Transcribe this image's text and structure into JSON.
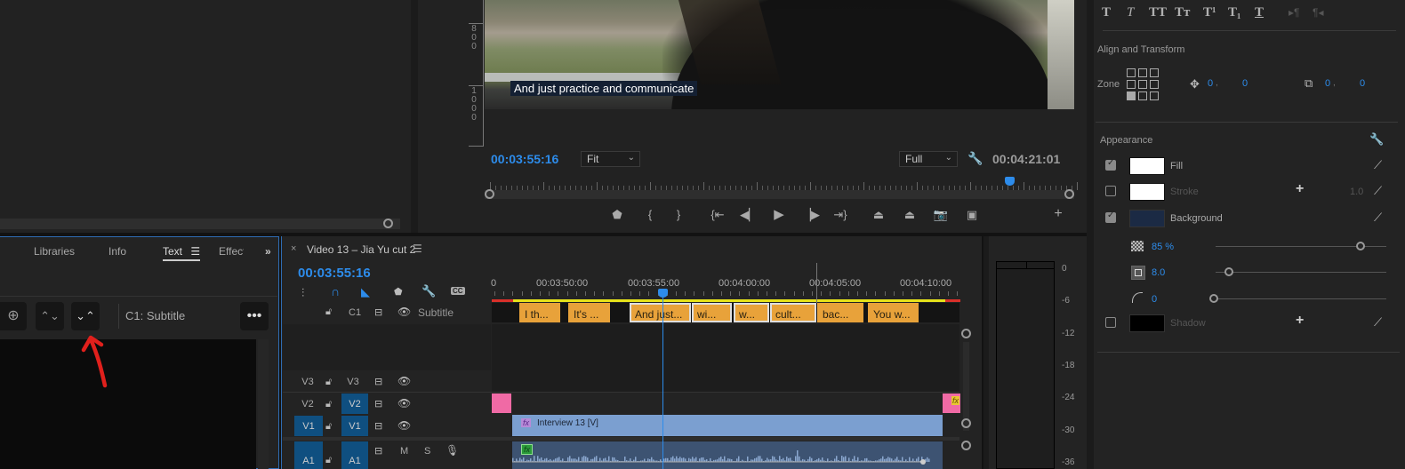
{
  "program_monitor": {
    "caption_text": "And just practice and communicate",
    "current_timecode": "00:03:55:16",
    "zoom_select": "Fit",
    "quality_select": "Full",
    "duration_timecode": "00:04:21:01",
    "ruler_numbers": [
      "8",
      "0",
      "0",
      "1",
      "0",
      "0",
      "0"
    ],
    "playhead_fraction": 0.89,
    "transport_icons": [
      "add-marker",
      "mark-in",
      "mark-out",
      "go-to-in",
      "step-back",
      "play",
      "step-forward",
      "go-to-out",
      "lift",
      "extract",
      "export-frame",
      "compare-view",
      "button-editor"
    ]
  },
  "text_panel": {
    "tabs": [
      {
        "label": "Libraries"
      },
      {
        "label": "Info"
      },
      {
        "label": "Text",
        "active": true
      },
      {
        "label": "Effect"
      }
    ],
    "overflow_icon": "»",
    "track_label": "C1: Subtitle",
    "toolbar_icons": [
      "add-caption",
      "split-caption",
      "merge-captions",
      "more-options"
    ]
  },
  "timeline": {
    "sequence_name": "Video 13 – Jia Yu cut 2",
    "current_timecode": "00:03:55:16",
    "ruler_labels": [
      "00:03:50:00",
      "00:03:55:00",
      "00:04:00:00",
      "00:04:05:00",
      "00:04:10:00"
    ],
    "caption_track": {
      "name": "C1",
      "label": "Subtitle"
    },
    "caption_clips": [
      {
        "text": "I th..."
      },
      {
        "text": "It's ..."
      },
      {
        "text": "And just...",
        "selected": true
      },
      {
        "text": "wi...",
        "selected": true
      },
      {
        "text": "w...",
        "selected": true
      },
      {
        "text": "cult...",
        "selected": true
      },
      {
        "text": "bac..."
      },
      {
        "text": "You w..."
      }
    ],
    "tracks": [
      {
        "src": "V3",
        "dst": "V3",
        "src_on": false,
        "dst_on": false
      },
      {
        "src": "V2",
        "dst": "V2",
        "src_on": false,
        "dst_on": true
      },
      {
        "src": "V1",
        "dst": "V1",
        "src_on": true,
        "dst_on": true
      },
      {
        "src": "A1",
        "dst": "A1",
        "src_on": true,
        "dst_on": true,
        "mute": "M",
        "solo": "S"
      }
    ],
    "video_clip_name": "Interview 13 [V]",
    "fx_badge": "fx"
  },
  "audio_meter": {
    "db_labels": [
      "0",
      "-6",
      "-12",
      "-18",
      "-24",
      "-30",
      "-36"
    ]
  },
  "essential_graphics": {
    "style_buttons": [
      "T",
      "T",
      "TT",
      "Tт",
      "T¹",
      "T₁",
      "T"
    ],
    "align_section": "Align and Transform",
    "zone_label": "Zone",
    "position": {
      "x": "0",
      "y": "0"
    },
    "anchor": {
      "x": "0",
      "y": "0"
    },
    "appearance_title": "Appearance",
    "fill": {
      "label": "Fill",
      "checked": true,
      "color": "#ffffff"
    },
    "stroke": {
      "label": "Stroke",
      "checked": false,
      "color": "#ffffff",
      "width": "1.0"
    },
    "background": {
      "label": "Background",
      "checked": true,
      "color": "#1b2a44"
    },
    "bg_opacity": {
      "value": "85 %",
      "fraction": 0.85
    },
    "bg_size": {
      "value": "8.0",
      "fraction": 0.08
    },
    "bg_corner": {
      "value": "0",
      "fraction": 0.0
    },
    "shadow": {
      "label": "Shadow",
      "checked": false,
      "color": "#000000"
    }
  },
  "colors": {
    "accent_blue": "#2d8ceb",
    "caption_clip": "#e8a23a",
    "video_clip": "#7b9fd0",
    "audio_clip": "#3d5372",
    "pink_clip": "#f06aa5",
    "annotation_red": "#e0201c"
  }
}
